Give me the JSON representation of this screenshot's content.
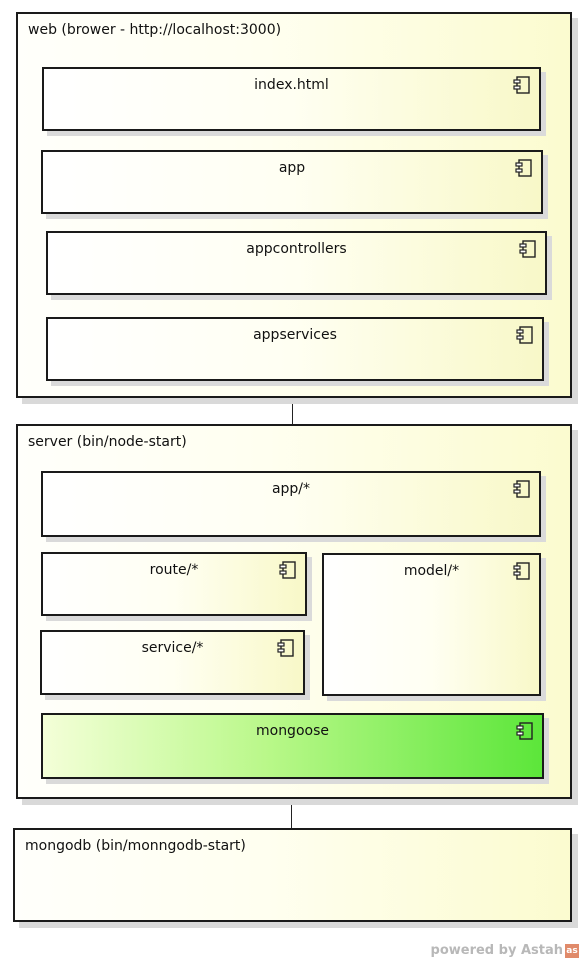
{
  "nodes": {
    "web": {
      "title": "web (brower - http://localhost:3000)",
      "components": [
        "index.html",
        "app",
        "appcontrollers",
        "appservices"
      ]
    },
    "server": {
      "title": "server (bin/node-start)",
      "components": [
        "app/*",
        "route/*",
        "model/*",
        "service/*",
        "mongoose"
      ]
    },
    "mongodb": {
      "title": "mongodb (bin/monngodb-start)"
    }
  },
  "footer": {
    "text": "powered by Astah",
    "mark": "as"
  },
  "colors": {
    "node_fill": "#fffff0",
    "component_fill": "#fffff2",
    "highlight_component": "#5ce63a",
    "border": "#1a1a1a"
  },
  "icons": {
    "component": "uml-component-icon"
  }
}
